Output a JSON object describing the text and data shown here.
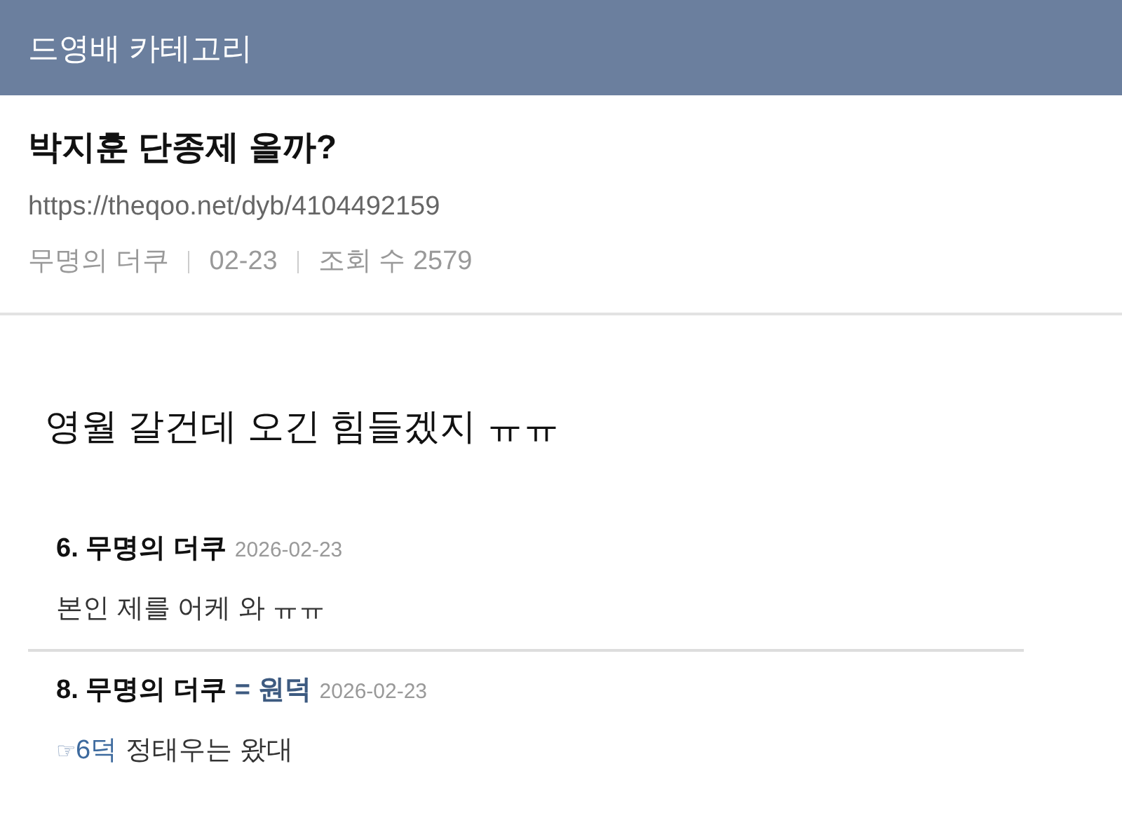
{
  "header": {
    "title": "드영배 카테고리"
  },
  "post": {
    "title": "박지훈 단종제 올까?",
    "url": "https://theqoo.net/dyb/4104492159",
    "author": "무명의 더쿠",
    "date": "02-23",
    "views": "조회 수 2579",
    "body": "영월 갈건데 오긴 힘들겠지 ㅠㅠ"
  },
  "comments": [
    {
      "number": "6.",
      "author": "무명의 더쿠",
      "date": "2026-02-23",
      "text": "본인 제를 어케 와 ㅠㅠ"
    },
    {
      "number": "8.",
      "author": "무명의 더쿠",
      "tag": "= 원덕",
      "date": "2026-02-23",
      "pointer": "☞",
      "mention": "6덕",
      "text": "정태우는 왔대"
    }
  ]
}
